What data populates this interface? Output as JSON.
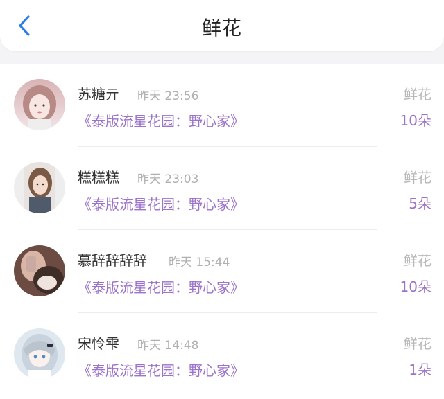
{
  "header": {
    "title": "鲜花",
    "back_icon": "chevron-left-icon",
    "accent": "#2c7fe8"
  },
  "records": [
    {
      "name": "苏糖亓",
      "time": "昨天 23:56",
      "book": "《泰版流星花园：野心家》",
      "gift": "鲜花",
      "count": "10朵"
    },
    {
      "name": "糕糕糕",
      "time": "昨天 23:03",
      "book": "《泰版流星花园：野心家》",
      "gift": "鲜花",
      "count": "5朵"
    },
    {
      "name": "慕辞辞辞辞",
      "time": "昨天 15:44",
      "book": "《泰版流星花园：野心家》",
      "gift": "鲜花",
      "count": "10朵"
    },
    {
      "name": "宋怜雫",
      "time": "昨天 14:48",
      "book": "《泰版流星花园：野心家》",
      "gift": "鲜花",
      "count": "1朵"
    }
  ],
  "colors": {
    "book": "#9b73c9",
    "time": "#b0b0b0",
    "gift": "#b8b8b8"
  }
}
